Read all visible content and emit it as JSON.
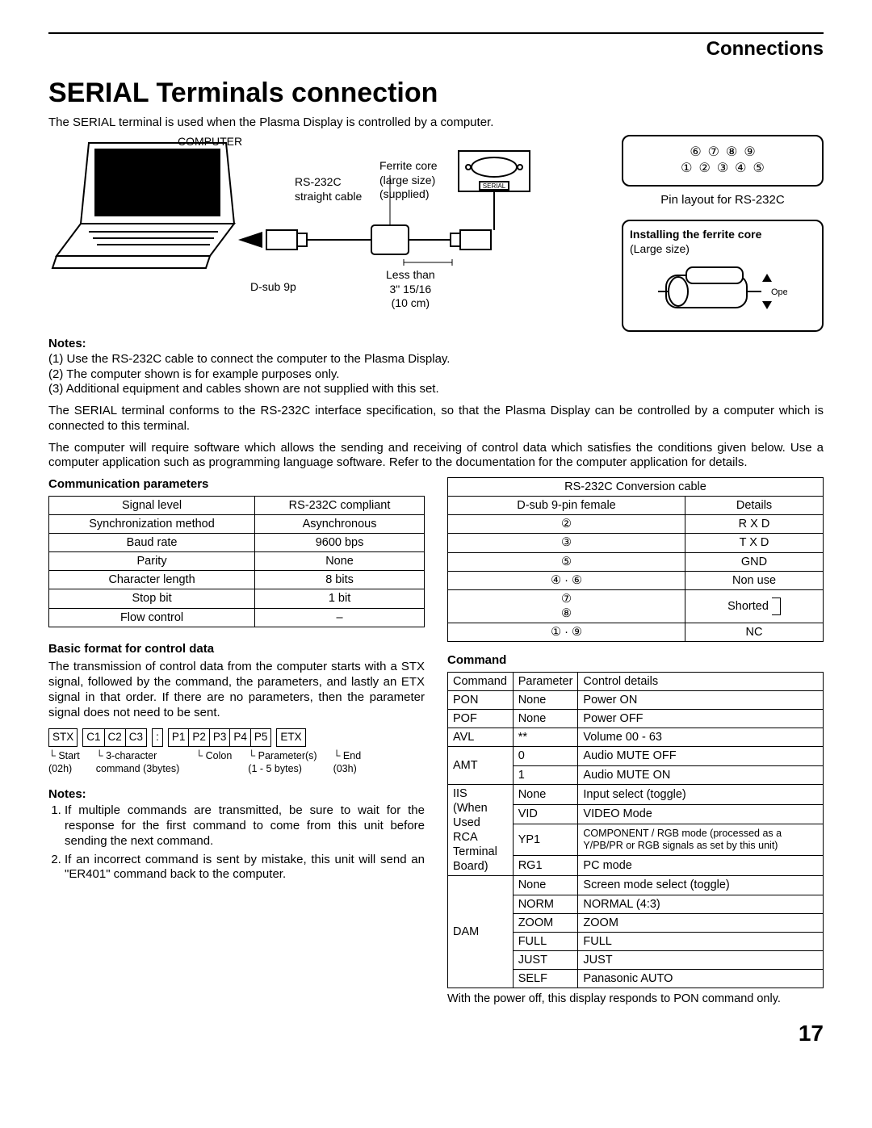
{
  "header": {
    "section": "Connections"
  },
  "title": "SERIAL Terminals connection",
  "intro": "The SERIAL terminal is used when the Plasma Display is controlled by a computer.",
  "diagram": {
    "computer": "COMPUTER",
    "cable": "RS-232C\nstraight cable",
    "ferrite": "Ferrite core\n(large size)\n(supplied)",
    "dsub": "D-sub 9p",
    "lessthan": "Less than\n3\" 15/16\n(10 cm)",
    "serial_port": "SERIAL"
  },
  "pin_layout": {
    "row1": [
      "⑥",
      "⑦",
      "⑧",
      "⑨"
    ],
    "row2": [
      "①",
      "②",
      "③",
      "④",
      "⑤"
    ],
    "caption": "Pin layout for RS-232C"
  },
  "ferrite_box": {
    "title": "Installing the ferrite core",
    "size": "(Large size)",
    "open": "Open"
  },
  "notes_top_label": "Notes:",
  "notes_top": [
    "Use the RS-232C cable to connect the computer to the Plasma Display.",
    "The computer shown is for example purposes only.",
    "Additional equipment and cables shown are not supplied with this set."
  ],
  "para1": "The SERIAL terminal conforms to the RS-232C interface specification, so that the Plasma Display can be controlled by a computer which is connected to this terminal.",
  "para2": "The computer will require software which allows the sending and receiving of control data which satisfies the conditions given below. Use a computer application such as programming language software. Refer to the documentation for the computer application for details.",
  "comm_params": {
    "heading": "Communication parameters",
    "rows": [
      [
        "Signal level",
        "RS-232C compliant"
      ],
      [
        "Synchronization method",
        "Asynchronous"
      ],
      [
        "Baud rate",
        "9600 bps"
      ],
      [
        "Parity",
        "None"
      ],
      [
        "Character length",
        "8 bits"
      ],
      [
        "Stop bit",
        "1 bit"
      ],
      [
        "Flow control",
        "–"
      ]
    ]
  },
  "basic_format": {
    "heading": "Basic format for control data",
    "text": "The transmission of control data from the computer starts with a STX signal, followed by the command, the parameters, and lastly an ETX signal in that order. If there are no parameters, then the parameter signal does not need to be sent.",
    "boxes": {
      "stx": "STX",
      "c": [
        "C1",
        "C2",
        "C3"
      ],
      "colon": ":",
      "p": [
        "P1",
        "P2",
        "P3",
        "P4",
        "P5"
      ],
      "etx": "ETX"
    },
    "labels": {
      "start": "Start\n(02h)",
      "cmd": "3-character\ncommand (3bytes)",
      "colon": "Colon",
      "params": "Parameter(s)\n(1 - 5 bytes)",
      "end": "End\n(03h)"
    }
  },
  "notes_bottom_label": "Notes:",
  "notes_bottom": [
    "If multiple commands are transmitted, be sure to wait for the response for the first command to come from this unit before sending the next command.",
    "If an incorrect command is sent by mistake, this unit will send an \"ER401\" command back to the computer."
  ],
  "conv_table": {
    "title": "RS-232C Conversion cable",
    "head": [
      "D-sub 9-pin female",
      "Details"
    ],
    "rows": [
      [
        "②",
        "R X D"
      ],
      [
        "③",
        "T X D"
      ],
      [
        "⑤",
        "GND"
      ],
      [
        "④ · ⑥",
        "Non use"
      ],
      [
        "⑦\n⑧",
        "Shorted"
      ],
      [
        "① · ⑨",
        "NC"
      ]
    ]
  },
  "command": {
    "heading": "Command",
    "head": [
      "Command",
      "Parameter",
      "Control details"
    ],
    "rows": [
      [
        "PON",
        "None",
        "Power ON"
      ],
      [
        "POF",
        "None",
        "Power OFF"
      ],
      [
        "AVL",
        "**",
        "Volume 00 - 63"
      ],
      [
        "AMT",
        "0",
        "Audio MUTE OFF"
      ],
      [
        "",
        "1",
        "Audio MUTE ON"
      ],
      [
        "IIS\n(When\nUsed RCA\nTerminal\nBoard)",
        "None",
        "Input select (toggle)"
      ],
      [
        "",
        "VID",
        "VIDEO Mode"
      ],
      [
        "",
        "YP1",
        "COMPONENT / RGB mode (processed as a Y/PB/PR or RGB signals as set by this unit)"
      ],
      [
        "",
        "RG1",
        "PC mode"
      ],
      [
        "DAM",
        "None",
        "Screen mode select (toggle)"
      ],
      [
        "",
        "NORM",
        "NORMAL (4:3)"
      ],
      [
        "",
        "ZOOM",
        "ZOOM"
      ],
      [
        "",
        "FULL",
        "FULL"
      ],
      [
        "",
        "JUST",
        "JUST"
      ],
      [
        "",
        "SELF",
        "Panasonic AUTO"
      ]
    ],
    "footnote": "With the power off, this display responds to PON command only."
  },
  "page_number": "17"
}
